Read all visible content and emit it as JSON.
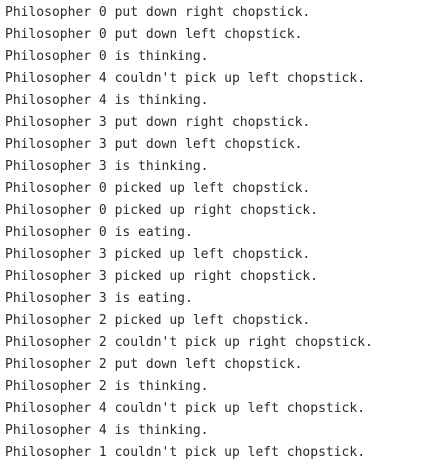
{
  "console": {
    "lines": [
      "Philosopher 0 put down right chopstick.",
      "Philosopher 0 put down left chopstick.",
      "Philosopher 0 is thinking.",
      "Philosopher 4 couldn't pick up left chopstick.",
      "Philosopher 4 is thinking.",
      "Philosopher 3 put down right chopstick.",
      "Philosopher 3 put down left chopstick.",
      "Philosopher 3 is thinking.",
      "Philosopher 0 picked up left chopstick.",
      "Philosopher 0 picked up right chopstick.",
      "Philosopher 0 is eating.",
      "Philosopher 3 picked up left chopstick.",
      "Philosopher 3 picked up right chopstick.",
      "Philosopher 3 is eating.",
      "Philosopher 2 picked up left chopstick.",
      "Philosopher 2 couldn't pick up right chopstick.",
      "Philosopher 2 put down left chopstick.",
      "Philosopher 2 is thinking.",
      "Philosopher 4 couldn't pick up left chopstick.",
      "Philosopher 4 is thinking.",
      "Philosopher 1 couldn't pick up left chopstick."
    ]
  }
}
